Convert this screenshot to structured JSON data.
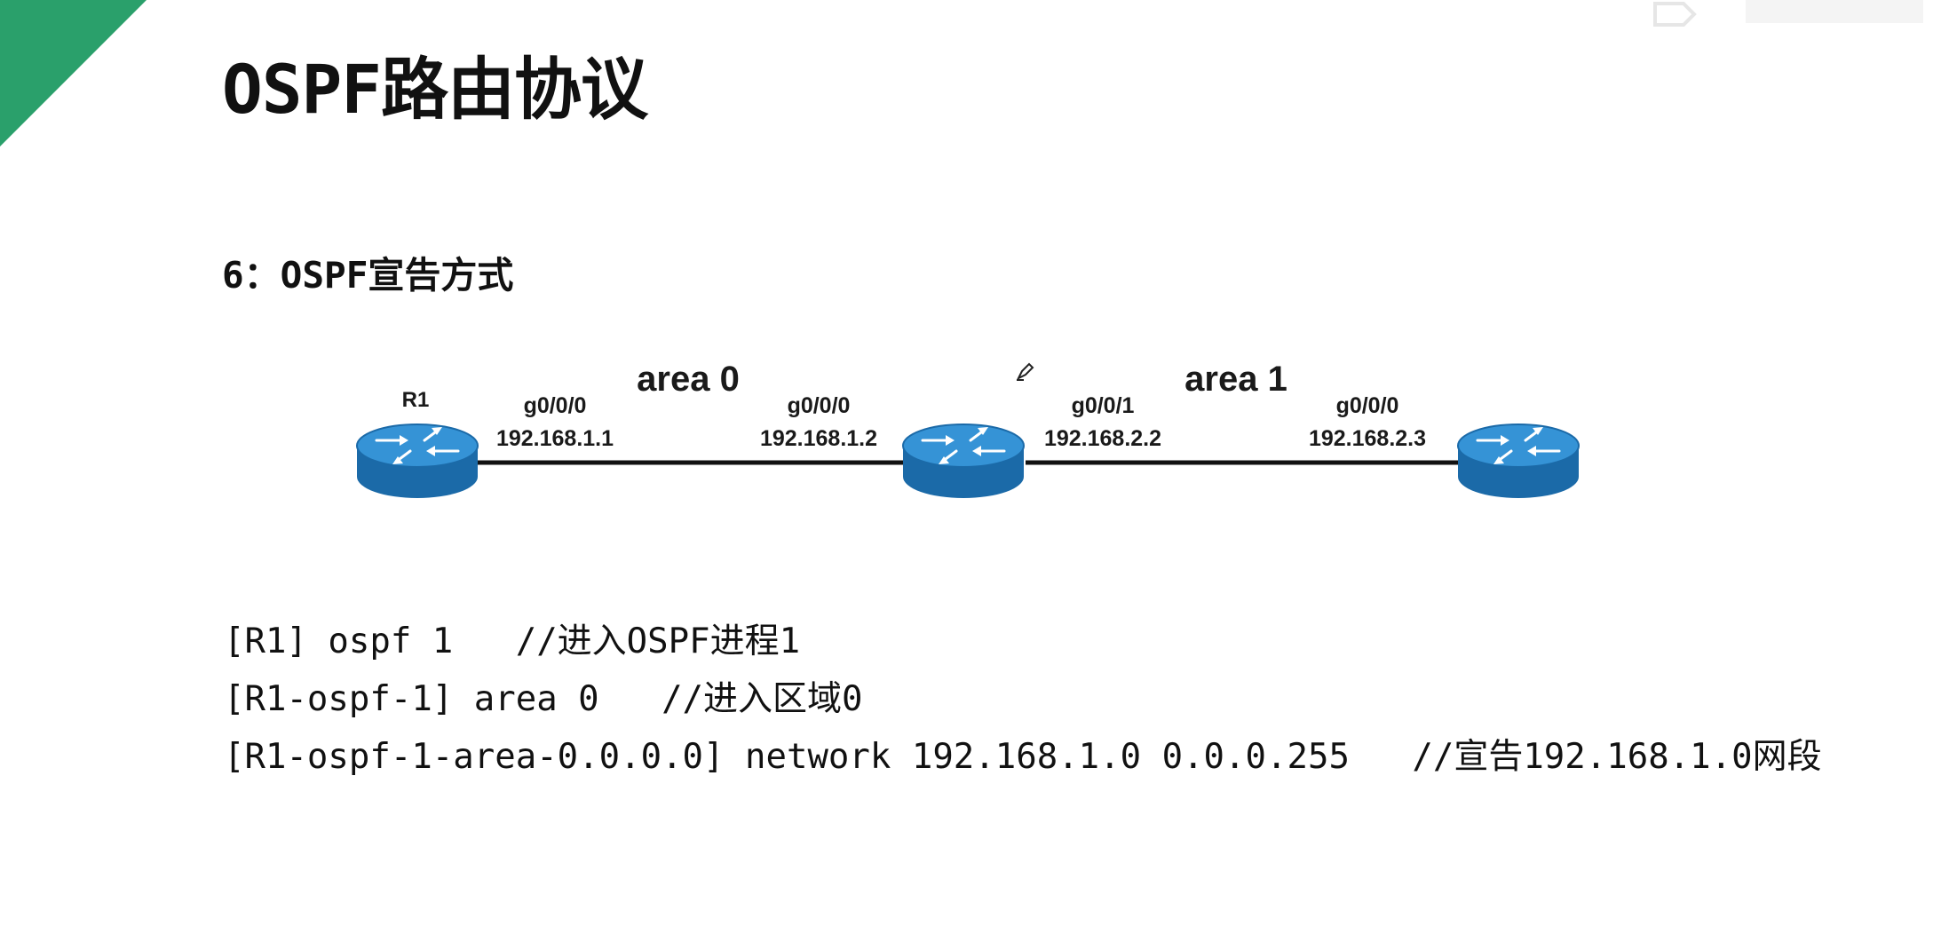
{
  "slide": {
    "title": "OSPF路由协议",
    "subtitle": "6：OSPF宣告方式"
  },
  "colors": {
    "corner_accent": "#2aa06b",
    "router_body": "#1e73b3",
    "router_top": "#2f8fd1",
    "link": "#111111"
  },
  "diagram": {
    "areas": [
      {
        "label": "area 0"
      },
      {
        "label": "area 1"
      }
    ],
    "routers": [
      {
        "name": "R1"
      },
      {
        "name": ""
      },
      {
        "name": ""
      }
    ],
    "interfaces": [
      {
        "port": "g0/0/0",
        "ip": "192.168.1.1"
      },
      {
        "port": "g0/0/0",
        "ip": "192.168.1.2"
      },
      {
        "port": "g0/0/1",
        "ip": "192.168.2.2"
      },
      {
        "port": "g0/0/0",
        "ip": "192.168.2.3"
      }
    ],
    "links": [
      {
        "from": "R1",
        "to": "router-2",
        "area": "area 0"
      },
      {
        "from": "router-2",
        "to": "router-3",
        "area": "area 1"
      }
    ]
  },
  "code_lines": [
    "[R1] ospf 1   //进入OSPF进程1",
    "[R1-ospf-1] area 0   //进入区域0",
    "[R1-ospf-1-area-0.0.0.0] network 192.168.1.0 0.0.0.255   //宣告192.168.1.0网段"
  ],
  "icons": {
    "corner": "green-triangle-corner",
    "watermark": "logo-watermark",
    "router": "router-icon",
    "cursor": "pen-cursor-icon"
  }
}
